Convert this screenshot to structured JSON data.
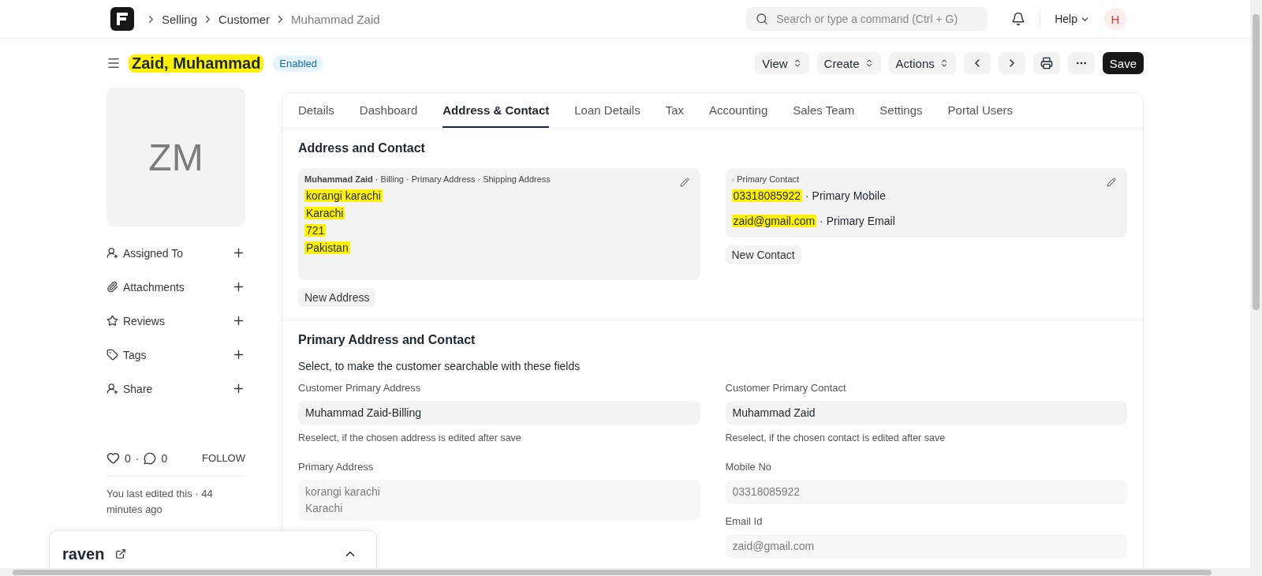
{
  "topbar": {
    "breadcrumbs": [
      {
        "label": "Selling",
        "current": false
      },
      {
        "label": "Customer",
        "current": false
      },
      {
        "label": "Muhammad Zaid",
        "current": true
      }
    ],
    "search": {
      "placeholder": "Search or type a command (Ctrl + G)"
    },
    "help": "Help",
    "avatar": "H"
  },
  "header": {
    "title": "Zaid, Muhammad",
    "title_highlighted": true,
    "status": "Enabled",
    "menus": [
      "View",
      "Create",
      "Actions"
    ],
    "primary_action": "Save"
  },
  "sidebar": {
    "initials": "ZM",
    "items": [
      {
        "label": "Assigned To"
      },
      {
        "label": "Attachments"
      },
      {
        "label": "Reviews"
      },
      {
        "label": "Tags"
      },
      {
        "label": "Share"
      }
    ],
    "likes": "0",
    "separator": "·",
    "comments": "0",
    "follow": "FOLLOW",
    "last_edited": "You last edited this · 44 minutes ago"
  },
  "tabs": [
    {
      "label": "Details",
      "selected": false
    },
    {
      "label": "Dashboard",
      "selected": false
    },
    {
      "label": "Address & Contact",
      "selected": true
    },
    {
      "label": "Loan Details",
      "selected": false
    },
    {
      "label": "Tax",
      "selected": false
    },
    {
      "label": "Accounting",
      "selected": false
    },
    {
      "label": "Sales Team",
      "selected": false
    },
    {
      "label": "Settings",
      "selected": false
    },
    {
      "label": "Portal Users",
      "selected": false
    }
  ],
  "address_section": {
    "title": "Address and Contact",
    "address_card": {
      "heading": "**Muhammad Zaid** · Billing · Primary Address · Shipping Address",
      "lines": [
        {
          "text": "korangi karachi",
          "highlighted": true
        },
        {
          "text": "Karachi",
          "highlighted": true
        },
        {
          "text": "721",
          "highlighted": true
        },
        {
          "text": "Pakistan",
          "highlighted": true
        }
      ]
    },
    "new_address": "New Address",
    "contact_card": {
      "heading": "· Primary Contact",
      "entries": [
        {
          "value": "03318085922",
          "label": "· Primary Mobile",
          "highlighted": true
        },
        {
          "value": "zaid@gmail.com",
          "label": "· Primary Email",
          "highlighted": true
        }
      ]
    },
    "new_contact": "New Contact"
  },
  "primary_section": {
    "title": "Primary Address and Contact",
    "subtitle": "Select, to make the customer searchable with these fields",
    "left_fields": [
      {
        "kind": "input",
        "label": "Customer Primary Address",
        "value": "Muhammad Zaid-Billing",
        "hint": "Reselect, if the chosen address is edited after save"
      },
      {
        "kind": "readonly",
        "label": "Primary Address",
        "lines": [
          "korangi karachi",
          "Karachi"
        ]
      }
    ],
    "right_fields": [
      {
        "kind": "input",
        "label": "Customer Primary Contact",
        "value": "Muhammad Zaid",
        "hint": "Reselect, if the chosen contact is edited after save"
      },
      {
        "kind": "readonly",
        "label": "Mobile No",
        "lines": [
          "03318085922"
        ]
      },
      {
        "kind": "readonly",
        "label": "Email Id",
        "lines": [
          "zaid@gmail.com"
        ]
      }
    ]
  },
  "raven": {
    "title": "raven"
  }
}
